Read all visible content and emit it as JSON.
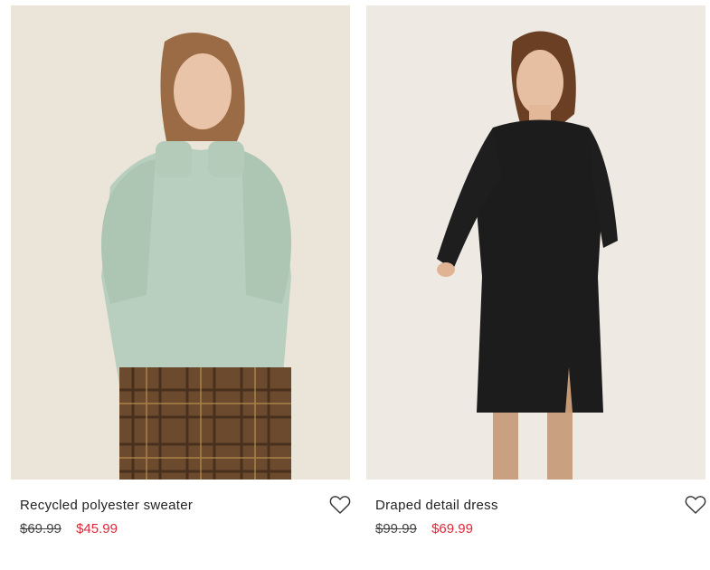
{
  "products": [
    {
      "title": "Recycled polyester sweater",
      "price_original": "$69.99",
      "price_sale": "$45.99",
      "wishlist_icon": "heart-outline-icon"
    },
    {
      "title": "Draped detail dress",
      "price_original": "$99.99",
      "price_sale": "$69.99",
      "wishlist_icon": "heart-outline-icon"
    }
  ],
  "colors": {
    "sale_price": "#e0283a",
    "text": "#222222"
  }
}
